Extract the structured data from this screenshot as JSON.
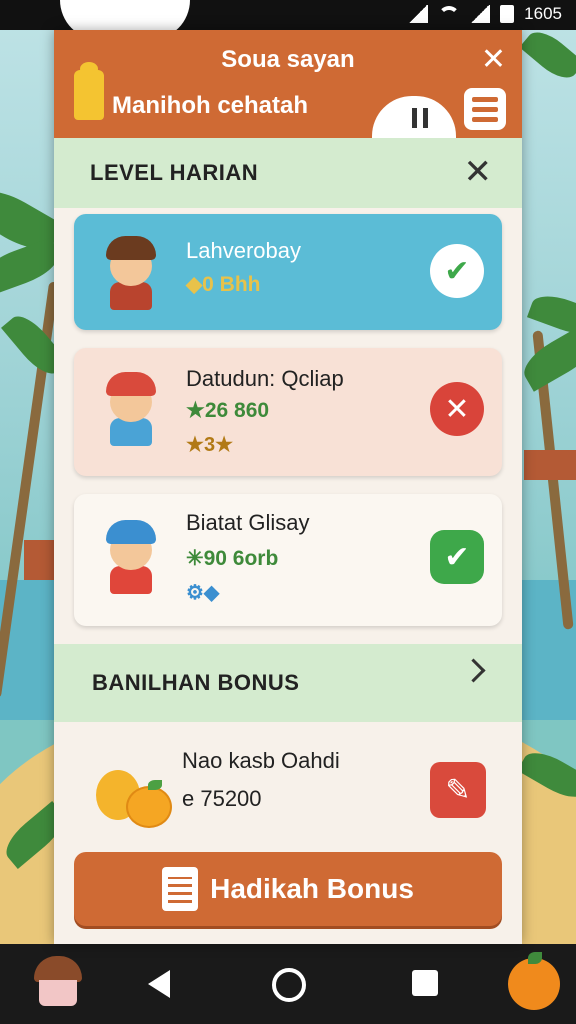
{
  "status_bar": {
    "time": "1605",
    "icons": [
      "signal-icon",
      "wifi-icon",
      "signal-icon",
      "battery-icon"
    ]
  },
  "header": {
    "title": "Soua sayan",
    "subtitle": "Manihoh cehatah",
    "icons": [
      "mascot-icon",
      "close-icon",
      "cloud-pause-icon",
      "menu-icon"
    ]
  },
  "daily_section": {
    "label": "LEVEL HARIAN",
    "items": [
      {
        "name": "Lahverobay",
        "value": "0 Bhh",
        "stars": "",
        "status": "completed",
        "status_icon": "check-icon",
        "bg": "#5bbcd6",
        "value_color": "#e8c24a"
      },
      {
        "name": "Datudun: Qcliap",
        "value": "26 860",
        "stars": "3",
        "status": "failed",
        "status_icon": "x-icon",
        "bg": "#f8e1d6",
        "value_color": "#3e8a3a"
      },
      {
        "name": "Biatat Glisay",
        "value": "90 6orb",
        "stars": "",
        "status": "completed",
        "status_icon": "check-icon",
        "bg": "#fbf7f1",
        "value_color": "#3e8a3a"
      }
    ]
  },
  "bonus_section": {
    "label": "BANILHAN BONUS",
    "item": {
      "name": "Nao kasb Oahdi",
      "value": "e 75200",
      "icon": "edit-icon"
    }
  },
  "main_button": {
    "label": "Hadikah Bonus",
    "icon": "calendar-icon"
  },
  "colors": {
    "accent": "#cf6a34",
    "section_bg": "#d4ebcf",
    "success": "#3ea84a",
    "danger": "#d9443a"
  }
}
